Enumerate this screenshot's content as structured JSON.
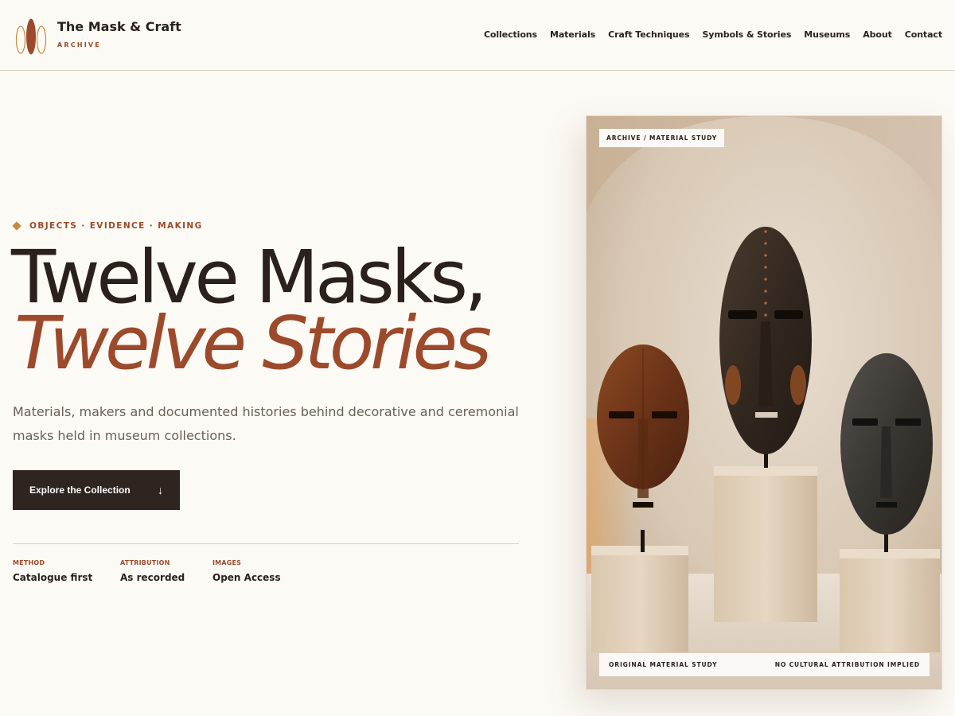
{
  "brand": {
    "name": "The Mask & Craft",
    "subtitle": "ARCHIVE",
    "logo_icon": "mask-trio-logo-icon"
  },
  "nav": {
    "items": [
      "Collections",
      "Materials",
      "Craft Techniques",
      "Symbols & Stories",
      "Museums",
      "About",
      "Contact"
    ]
  },
  "hero": {
    "eyebrow": "OBJECTS · EVIDENCE · MAKING",
    "title_line1": "Twelve Masks,",
    "title_line2": "Twelve Stories",
    "description": "Materials, makers and documented histories behind decorative and ceremonial masks held in museum collections.",
    "cta_label": "Explore the Collection",
    "cta_icon": "↓",
    "stats": [
      {
        "label": "METHOD",
        "value": "Catalogue first"
      },
      {
        "label": "ATTRIBUTION",
        "value": "As recorded"
      },
      {
        "label": "IMAGES",
        "value": "Open Access"
      }
    ]
  },
  "figure": {
    "tag": "ARCHIVE / MATERIAL STUDY",
    "caption_left": "ORIGINAL MATERIAL STUDY",
    "caption_right": "NO CULTURAL ATTRIBUTION IMPLIED"
  },
  "colors": {
    "background": "#fcfaf5",
    "text": "#2a211c",
    "accent": "#9c4a2b",
    "diamond": "#c48a3c",
    "cta_bg": "#2e2520",
    "border": "#dcd2c2"
  }
}
